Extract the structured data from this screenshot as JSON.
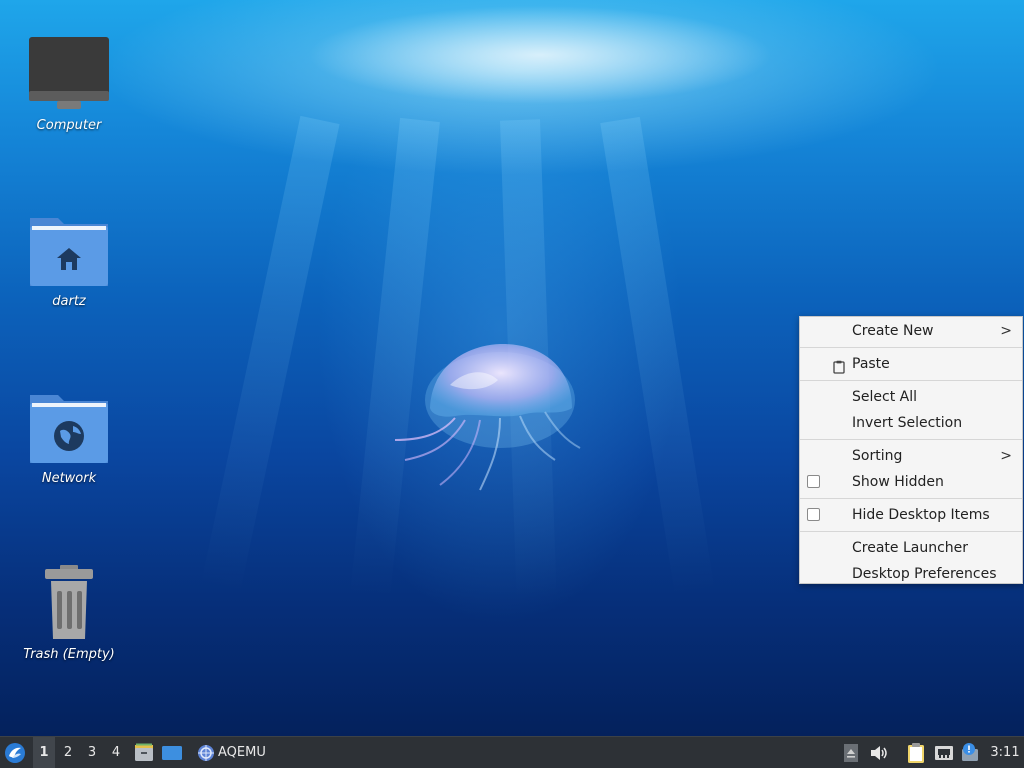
{
  "desktop": {
    "icons": [
      {
        "label": "Computer",
        "icon": "computer-icon"
      },
      {
        "label": "dartz",
        "icon": "home-folder-icon"
      },
      {
        "label": "Network",
        "icon": "network-folder-icon"
      },
      {
        "label": "Trash (Empty)",
        "icon": "trash-icon"
      }
    ]
  },
  "context_menu": {
    "items": [
      {
        "label": "Create New",
        "submenu": true
      },
      {
        "label": "Paste",
        "icon": "paste-icon"
      },
      {
        "label": "Select All"
      },
      {
        "label": "Invert Selection"
      },
      {
        "label": "Sorting",
        "submenu": true
      },
      {
        "label": "Show Hidden",
        "checkbox": true,
        "checked": false
      },
      {
        "label": "Hide Desktop Items",
        "checkbox": true,
        "checked": false
      },
      {
        "label": "Create Launcher"
      },
      {
        "label": "Desktop Preferences"
      }
    ],
    "submenu_arrow": ">"
  },
  "taskbar": {
    "start_icon": "lubuntu-logo-icon",
    "workspaces": [
      "1",
      "2",
      "3",
      "4"
    ],
    "active_workspace": "1",
    "launchers": [
      "file-manager-icon",
      "show-desktop-icon"
    ],
    "task": {
      "label": "AQEMU",
      "icon": "aqemu-icon"
    },
    "tray_icons": [
      "eject-icon",
      "volume-icon",
      "clipboard-icon",
      "network-icon",
      "update-notifier-icon"
    ],
    "clock": "3:11"
  },
  "colors": {
    "taskbar_bg": "#2d3136",
    "menu_bg": "#f5f5f5",
    "folder_blue": "#5b9be6"
  }
}
